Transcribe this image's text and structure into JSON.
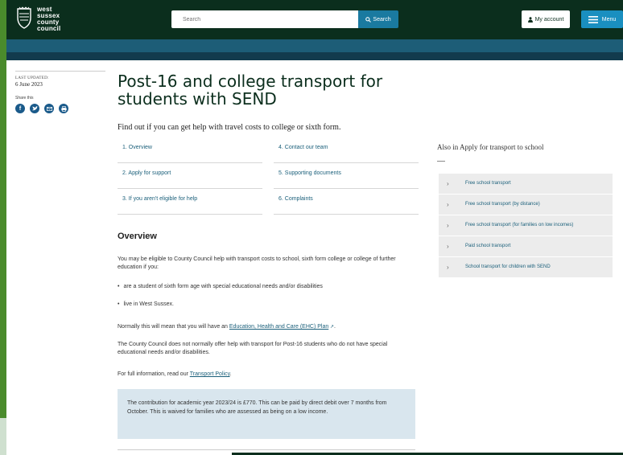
{
  "header": {
    "logo_lines": [
      "west",
      "sussex",
      "county",
      "council"
    ],
    "search_placeholder": "Search",
    "search_button": "Search",
    "account_label": "My account",
    "menu_label": "Menu"
  },
  "meta": {
    "last_updated_label": "LAST UPDATED:",
    "last_updated_date": "6 June 2023",
    "share_label": "Share this",
    "share_icons": [
      "facebook-icon",
      "twitter-icon",
      "email-icon",
      "print-icon"
    ]
  },
  "page": {
    "title": "Post-16 and college transport for students with SEND",
    "lead": "Find out if you can get help with travel costs to college or sixth form."
  },
  "toc": [
    {
      "label": "1. Overview"
    },
    {
      "label": "4. Contact our team"
    },
    {
      "label": "2. Apply for support"
    },
    {
      "label": "5. Supporting documents"
    },
    {
      "label": "3. If you aren't eligible for help"
    },
    {
      "label": "6. Complaints"
    }
  ],
  "overview": {
    "heading": "Overview",
    "para1": "You may be eligible to County Council help with transport costs to school, sixth form college or college of further education if you:",
    "bullets": [
      "are a student of sixth form age with special educational needs and/or disabilities",
      "live in West Sussex."
    ],
    "para2_prefix": "Normally this will mean that you will have an ",
    "para2_link": "Education, Health and Care (EHC) Plan",
    "para2_suffix": ".",
    "para3": "The County Council does not normally offer help with transport for Post-16 students who do not have special educational needs and/or disabilities.",
    "para4_prefix": "For full information, read our ",
    "para4_link": "Transport Policy",
    "para4_suffix": ".",
    "callout": "The contribution for academic year 2023/24 is £770. This can be paid by direct debit over 7 months from October. This is waived for families who are assessed as being on a low income."
  },
  "aside": {
    "title": "Also in Apply for transport to school",
    "items": [
      "Free school transport",
      "Free school transport (by distance)",
      "Free school transport (for families on low incomes)",
      "Paid school transport",
      "School transport for children with SEND"
    ]
  },
  "colors": {
    "header_bg": "#0b2e1d",
    "band": "#1d5d77",
    "link": "#1a5f7a",
    "callout_bg": "#d9e6ee",
    "page_border": "#4a8b2c"
  }
}
